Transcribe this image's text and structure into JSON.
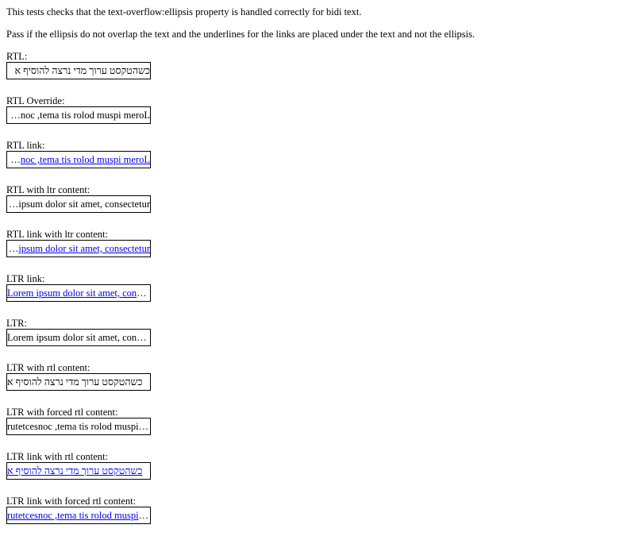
{
  "intro": {
    "line1": "This tests checks that the text-overflow:ellipsis property is handled correctly for bidi text.",
    "line2": "Pass if the ellipsis do not overlap the text and the underlines for the links are placed under the text and not the ellipsis."
  },
  "cases": [
    {
      "label": "RTL:",
      "text": "כשהטקסט ערוך מדי נרצה להוסיף א"
    },
    {
      "label": "RTL Override:",
      "text": "Lorem ipsum dolor sit amet, consectetur"
    },
    {
      "label": "RTL link:",
      "text": "Lorem ipsum dolor sit amet, consectetur"
    },
    {
      "label": "RTL with ltr content:",
      "text": "Lorem ipsum dolor sit amet, consectetur"
    },
    {
      "label": "RTL link with ltr content:",
      "text": "Lorem ipsum dolor sit amet, consectetur"
    },
    {
      "label": "LTR link:",
      "text": "Lorem ipsum dolor sit amet, consectetur"
    },
    {
      "label": "LTR:",
      "text": "Lorem ipsum dolor sit amet, consectetur"
    },
    {
      "label": "LTR with rtl content:",
      "text": "כשהטקסט ערוך מדי נרצה להוסיף א"
    },
    {
      "label": "LTR with forced rtl content:",
      "text": "Lorem ipsum dolor sit amet, consectetur"
    },
    {
      "label": "LTR link with rtl content:",
      "text": "כשהטקסט ערוך מדי נרצה להוסיף א"
    },
    {
      "label": "LTR link with forced rtl content:",
      "text": "Lorem ipsum dolor sit amet, consectetur"
    }
  ]
}
